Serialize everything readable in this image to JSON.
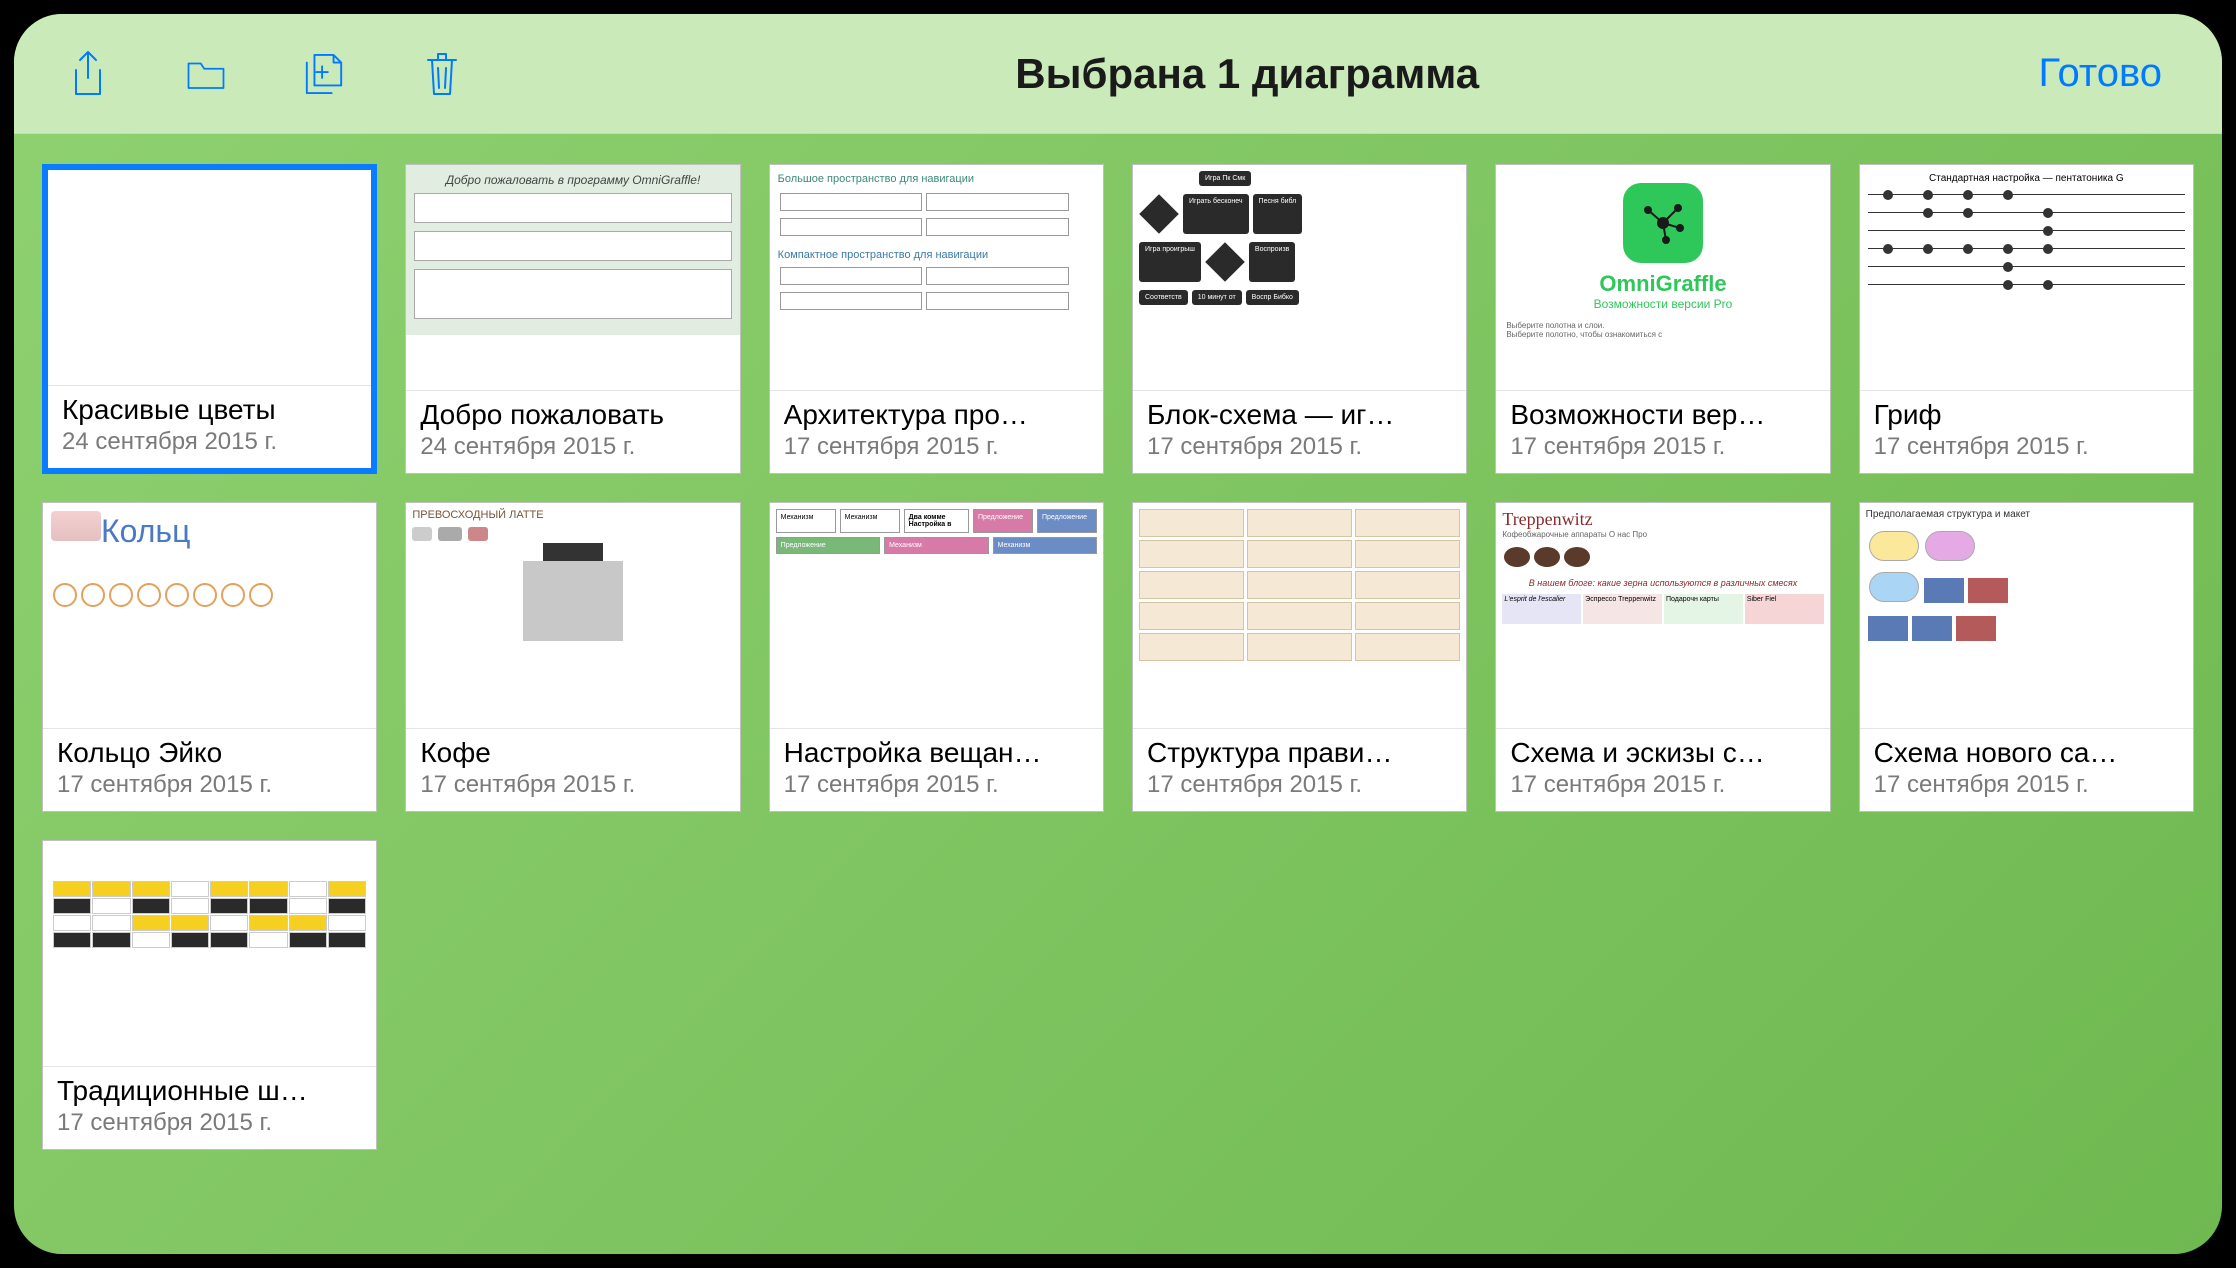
{
  "toolbar": {
    "title": "Выбрана 1 диаграмма",
    "done_label": "Готово"
  },
  "documents": [
    {
      "id": "doc-0",
      "title": "Красивые цветы",
      "date": "24 сентября 2015 г.",
      "selected": true,
      "preview_type": "blank"
    },
    {
      "id": "doc-1",
      "title": "Добро пожаловать",
      "date": "24 сентября 2015 г.",
      "selected": false,
      "preview_type": "welcome",
      "preview_text": "Добро пожаловать в программу OmniGraffle!"
    },
    {
      "id": "doc-2",
      "title": "Архитектура про…",
      "date": "17 сентября 2015 г.",
      "selected": false,
      "preview_type": "arch",
      "preview_text1": "Большое пространство для навигации",
      "preview_text2": "Компактное пространство для навигации"
    },
    {
      "id": "doc-3",
      "title": "Блок-схема — иг…",
      "date": "17 сентября 2015 г.",
      "selected": false,
      "preview_type": "flowchart"
    },
    {
      "id": "doc-4",
      "title": "Возможности вер…",
      "date": "17 сентября 2015 г.",
      "selected": false,
      "preview_type": "omni",
      "preview_brand": "OmniGraffle",
      "preview_sub": "Возможности версии Pro",
      "preview_foot": "Выберите полотна и слои.\nВыберите полотно, чтобы ознакомиться с"
    },
    {
      "id": "doc-5",
      "title": "Гриф",
      "date": "17 сентября 2015 г.",
      "selected": false,
      "preview_type": "grif",
      "preview_text": "Стандартная настройка — пентатоника G"
    },
    {
      "id": "doc-6",
      "title": "Кольцо Эйко",
      "date": "17 сентября 2015 г.",
      "selected": false,
      "preview_type": "ring",
      "preview_text": "Кольц"
    },
    {
      "id": "doc-7",
      "title": "Кофе",
      "date": "17 сентября 2015 г.",
      "selected": false,
      "preview_type": "coffee",
      "preview_text": "ПРЕВОСХОДНЫЙ ЛАТТЕ"
    },
    {
      "id": "doc-8",
      "title": "Настройка вещан…",
      "date": "17 сентября 2015 г.",
      "selected": false,
      "preview_type": "broadcast",
      "preview_text": "Два комме\nНастройка в"
    },
    {
      "id": "doc-9",
      "title": "Структура прави…",
      "date": "17 сентября 2015 г.",
      "selected": false,
      "preview_type": "structure"
    },
    {
      "id": "doc-10",
      "title": "Схема и эскизы с…",
      "date": "17 сентября 2015 г.",
      "selected": false,
      "preview_type": "treppen",
      "preview_brand": "Treppenwitz",
      "preview_sub": "Кофеобжарочные аппараты   О нас   Про",
      "preview_text": "В нашем блоге: какие зерна используются в различных смесях"
    },
    {
      "id": "doc-11",
      "title": "Схема нового са…",
      "date": "17 сентября 2015 г.",
      "selected": false,
      "preview_type": "newsite",
      "preview_text": "Предполагаемая структура и макет"
    },
    {
      "id": "doc-12",
      "title": "Традиционные ш…",
      "date": "17 сентября 2015 г.",
      "selected": false,
      "preview_type": "socks"
    }
  ]
}
